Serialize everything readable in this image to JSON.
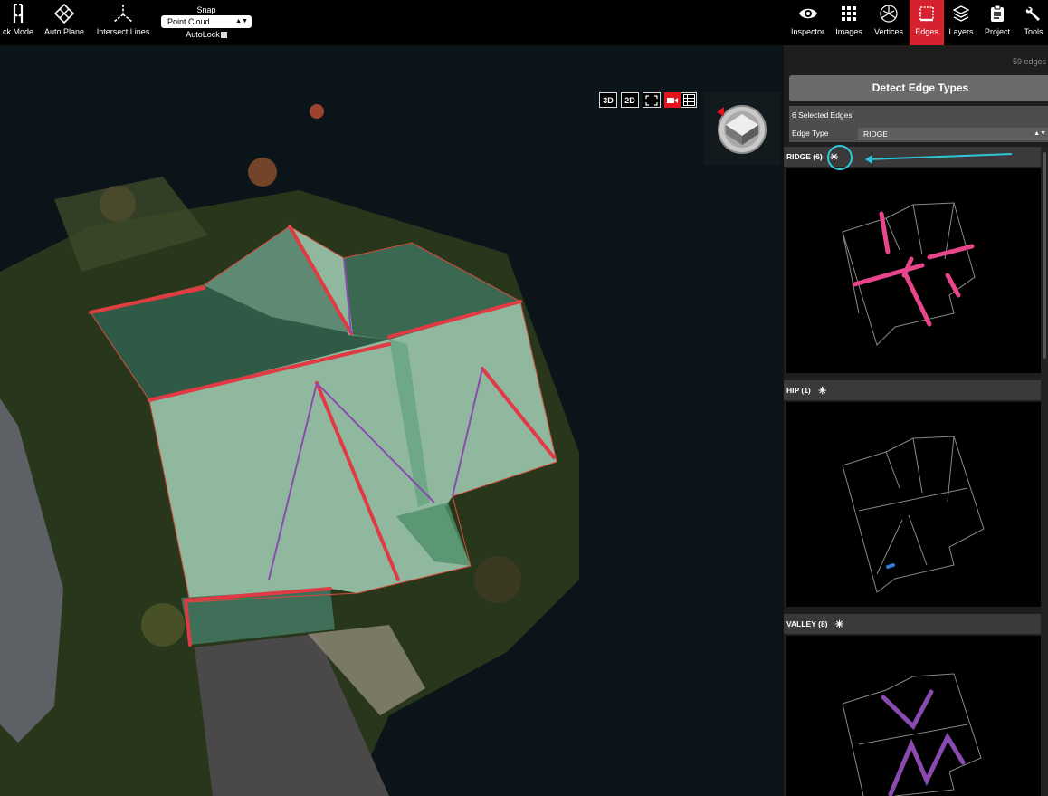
{
  "toolbar": {
    "left_tools": [
      {
        "label": "ck Mode",
        "icon": "pin-icon"
      },
      {
        "label": "Auto Plane",
        "icon": "diamond-grid-icon"
      },
      {
        "label": "Intersect Lines",
        "icon": "axes-icon"
      }
    ],
    "snap": {
      "title": "Snap",
      "selected": "Point Cloud",
      "autolock_label": "AutoLock"
    },
    "right_tools": [
      {
        "label": "Inspector",
        "icon": "eye-icon",
        "active": false
      },
      {
        "label": "Images",
        "icon": "grid-icon",
        "active": false
      },
      {
        "label": "Vertices",
        "icon": "vertices-icon",
        "active": false
      },
      {
        "label": "Edges",
        "icon": "edges-icon",
        "active": true
      },
      {
        "label": "Layers",
        "icon": "layers-icon",
        "active": false
      },
      {
        "label": "Project",
        "icon": "clipboard-icon",
        "active": false
      },
      {
        "label": "Tools",
        "icon": "wrench-icon",
        "active": false
      }
    ],
    "active_color": "#d6212f"
  },
  "viewport": {
    "controls": [
      "3D",
      "2D"
    ],
    "record_color": "#e3141e"
  },
  "panel": {
    "edge_count": "59 edges",
    "detect_button": "Detect Edge Types",
    "selected_edges": "6 Selected Edges",
    "edge_type_label": "Edge Type",
    "edge_type_value": "RIDGE",
    "sections": [
      {
        "label": "RIDGE (6)",
        "color": "#e8458c"
      },
      {
        "label": "HIP (1)",
        "color": "#2f7bd6"
      },
      {
        "label": "VALLEY (8)",
        "color": "#8a4bb0"
      }
    ]
  }
}
